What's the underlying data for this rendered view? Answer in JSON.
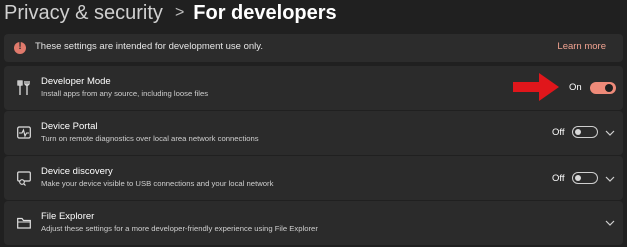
{
  "breadcrumb": {
    "parent": "Privacy & security",
    "separator": ">",
    "current": "For developers"
  },
  "banner": {
    "message": "These settings are intended for development use only.",
    "link": "Learn more",
    "icon": "warning-icon",
    "icon_color": "#e07a6c"
  },
  "settings": [
    {
      "title": "Developer Mode",
      "description": "Install apps from any source, including loose files",
      "state": "On",
      "enabled": true,
      "icon": "developer-tools-icon"
    },
    {
      "title": "Device Portal",
      "description": "Turn on remote diagnostics over local area network connections",
      "state": "Off",
      "enabled": false,
      "icon": "pulse-monitor-icon"
    },
    {
      "title": "Device discovery",
      "description": "Make your device visible to USB connections and your local network",
      "state": "Off",
      "enabled": false,
      "icon": "device-search-icon"
    },
    {
      "title": "File Explorer",
      "description": "Adjust these settings for a more developer-friendly experience using File Explorer",
      "icon": "folder-icon"
    }
  ],
  "colors": {
    "background": "#202020",
    "card": "#2b2b2b",
    "accent": "#ee8a79",
    "annotation_arrow": "#e0161b"
  }
}
